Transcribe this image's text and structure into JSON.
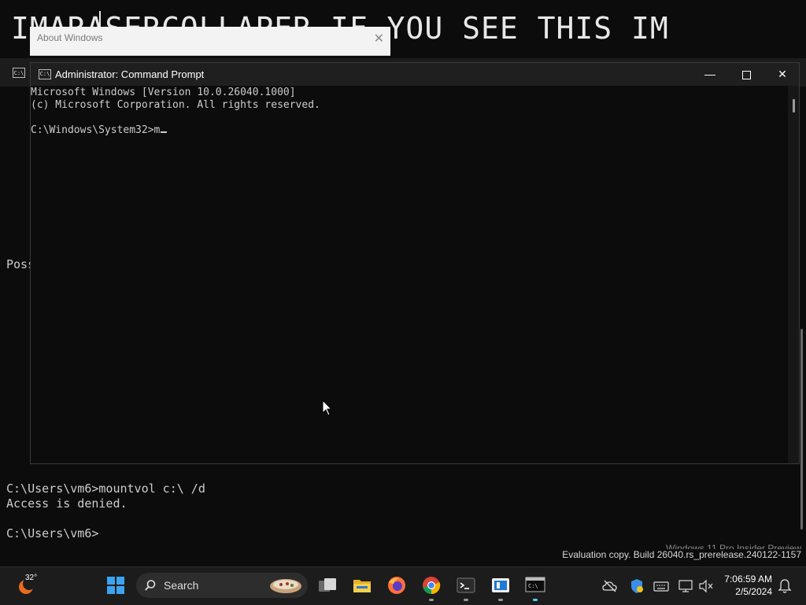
{
  "background_console": {
    "heading": "IMARASERCOLLAPER IF YOU SEE THIS IM",
    "partial_text": "Poss",
    "lines": [
      "C:\\Users\\vm6>mountvol c:\\ /d",
      "Access is denied.",
      "",
      "C:\\Users\\vm6>"
    ]
  },
  "about_dialog": {
    "title": "About Windows"
  },
  "cmd_window": {
    "title": "Administrator: Command Prompt",
    "lines": [
      "Microsoft Windows [Version 10.0.26040.1000]",
      "(c) Microsoft Corporation. All rights reserved.",
      "",
      "C:\\Windows\\System32>m"
    ]
  },
  "watermark": {
    "line1": "Windows 11 Pro Insider Preview",
    "line2": "Evaluation copy. Build 26040.rs_prerelease.240122-1157"
  },
  "taskbar": {
    "weather_temp": "32°",
    "search_label": "Search",
    "clock_time": "7:06:59 AM",
    "clock_date": "2/5/2024",
    "icons": [
      "weather-icon",
      "start-icon",
      "search-icon",
      "task-view-icon",
      "file-explorer-icon",
      "firefox-icon",
      "chrome-icon",
      "terminal-icon",
      "remote-icon",
      "cmd-icon",
      "cloud-offline-icon",
      "defender-icon",
      "keyboard-icon",
      "network-icon",
      "volume-muted-icon",
      "notification-bell-icon"
    ]
  }
}
